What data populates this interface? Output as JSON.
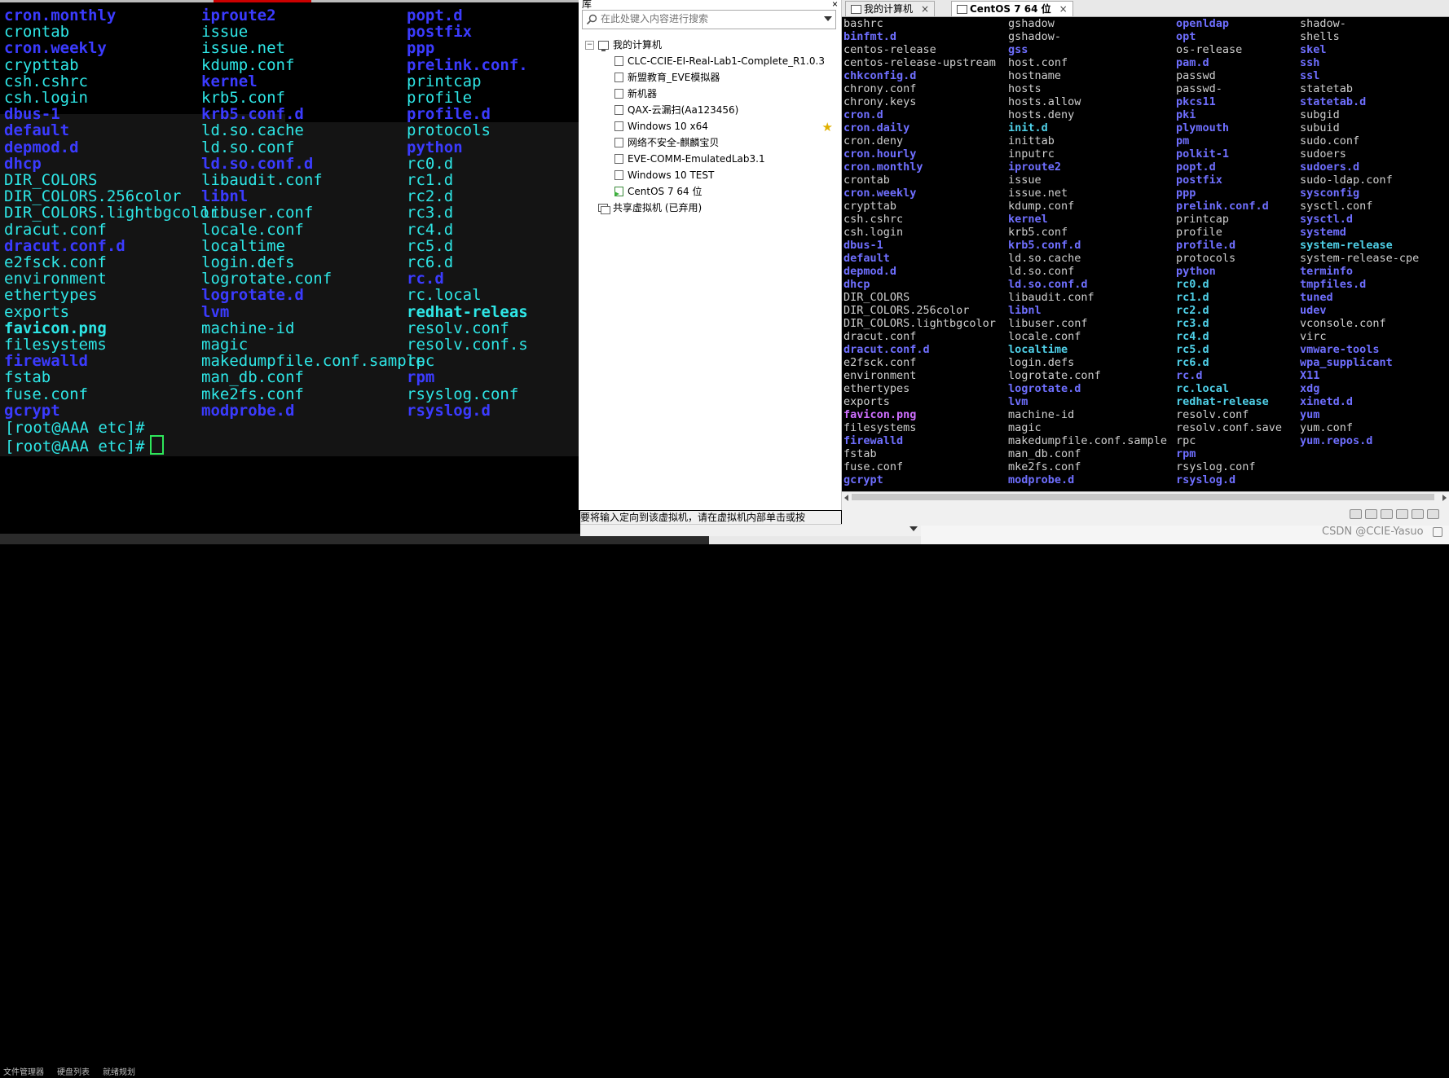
{
  "left_terminal": {
    "columns": [
      [
        {
          "t": "cron.monthly",
          "c": "blue"
        },
        {
          "t": "crontab",
          "c": "cyan"
        },
        {
          "t": "cron.weekly",
          "c": "blue"
        },
        {
          "t": "crypttab",
          "c": "cyan"
        },
        {
          "t": "csh.cshrc",
          "c": "cyan"
        },
        {
          "t": "csh.login",
          "c": "cyan"
        },
        {
          "t": "dbus-1",
          "c": "blue"
        },
        {
          "t": "default",
          "c": "blue"
        },
        {
          "t": "depmod.d",
          "c": "blue"
        },
        {
          "t": "dhcp",
          "c": "blue"
        },
        {
          "t": "DIR_COLORS",
          "c": "cyan"
        },
        {
          "t": "DIR_COLORS.256color",
          "c": "cyan"
        },
        {
          "t": "DIR_COLORS.lightbgcolor",
          "c": "cyan"
        },
        {
          "t": "dracut.conf",
          "c": "cyan"
        },
        {
          "t": "dracut.conf.d",
          "c": "blue"
        },
        {
          "t": "e2fsck.conf",
          "c": "cyan"
        },
        {
          "t": "environment",
          "c": "cyan"
        },
        {
          "t": "ethertypes",
          "c": "cyan"
        },
        {
          "t": "exports",
          "c": "cyan"
        },
        {
          "t": "favicon.png",
          "c": "cyan-bold"
        },
        {
          "t": "filesystems",
          "c": "cyan"
        },
        {
          "t": "firewalld",
          "c": "blue"
        },
        {
          "t": "fstab",
          "c": "cyan"
        },
        {
          "t": "fuse.conf",
          "c": "cyan"
        },
        {
          "t": "gcrypt",
          "c": "blue"
        }
      ],
      [
        {
          "t": "iproute2",
          "c": "blue"
        },
        {
          "t": "issue",
          "c": "cyan"
        },
        {
          "t": "issue.net",
          "c": "cyan"
        },
        {
          "t": "kdump.conf",
          "c": "cyan"
        },
        {
          "t": "kernel",
          "c": "blue"
        },
        {
          "t": "krb5.conf",
          "c": "cyan"
        },
        {
          "t": "krb5.conf.d",
          "c": "blue"
        },
        {
          "t": "ld.so.cache",
          "c": "cyan"
        },
        {
          "t": "ld.so.conf",
          "c": "cyan"
        },
        {
          "t": "ld.so.conf.d",
          "c": "blue"
        },
        {
          "t": "libaudit.conf",
          "c": "cyan"
        },
        {
          "t": "libnl",
          "c": "blue"
        },
        {
          "t": "libuser.conf",
          "c": "cyan"
        },
        {
          "t": "locale.conf",
          "c": "cyan"
        },
        {
          "t": "localtime",
          "c": "cyan"
        },
        {
          "t": "login.defs",
          "c": "cyan"
        },
        {
          "t": "logrotate.conf",
          "c": "cyan"
        },
        {
          "t": "logrotate.d",
          "c": "blue"
        },
        {
          "t": "lvm",
          "c": "blue"
        },
        {
          "t": "machine-id",
          "c": "cyan"
        },
        {
          "t": "magic",
          "c": "cyan"
        },
        {
          "t": "makedumpfile.conf.sample",
          "c": "cyan"
        },
        {
          "t": "man_db.conf",
          "c": "cyan"
        },
        {
          "t": "mke2fs.conf",
          "c": "cyan"
        },
        {
          "t": "modprobe.d",
          "c": "blue"
        }
      ],
      [
        {
          "t": "popt.d",
          "c": "blue"
        },
        {
          "t": "postfix",
          "c": "blue"
        },
        {
          "t": "ppp",
          "c": "blue"
        },
        {
          "t": "prelink.conf.",
          "c": "blue"
        },
        {
          "t": "printcap",
          "c": "cyan"
        },
        {
          "t": "profile",
          "c": "cyan"
        },
        {
          "t": "profile.d",
          "c": "blue"
        },
        {
          "t": "protocols",
          "c": "cyan"
        },
        {
          "t": "python",
          "c": "blue"
        },
        {
          "t": "rc0.d",
          "c": "cyan"
        },
        {
          "t": "rc1.d",
          "c": "cyan"
        },
        {
          "t": "rc2.d",
          "c": "cyan"
        },
        {
          "t": "rc3.d",
          "c": "cyan"
        },
        {
          "t": "rc4.d",
          "c": "cyan"
        },
        {
          "t": "rc5.d",
          "c": "cyan"
        },
        {
          "t": "rc6.d",
          "c": "cyan"
        },
        {
          "t": "rc.d",
          "c": "blue"
        },
        {
          "t": "rc.local",
          "c": "cyan"
        },
        {
          "t": "redhat-releas",
          "c": "cyan-bold"
        },
        {
          "t": "resolv.conf",
          "c": "cyan"
        },
        {
          "t": "resolv.conf.s",
          "c": "cyan"
        },
        {
          "t": "rpc",
          "c": "cyan"
        },
        {
          "t": "rpm",
          "c": "blue"
        },
        {
          "t": "rsyslog.conf",
          "c": "cyan"
        },
        {
          "t": "rsyslog.d",
          "c": "blue"
        }
      ]
    ],
    "prompts": [
      "[root@AAA etc]#",
      "[root@AAA etc]#"
    ]
  },
  "library": {
    "title": "库",
    "close_label": "×",
    "search_placeholder": "在此处键入内容进行搜索",
    "root": {
      "label": "我的计算机",
      "toggle": "−"
    },
    "vms": [
      {
        "label": "CLC-CCIE-EI-Real-Lab1-Complete_R1.0.3",
        "running": false,
        "star": false
      },
      {
        "label": "新盟教育_EVE模拟器",
        "running": false,
        "star": false
      },
      {
        "label": "新机器",
        "running": false,
        "star": false
      },
      {
        "label": "QAX-云漏扫(Aa123456)",
        "running": false,
        "star": false
      },
      {
        "label": "Windows 10 x64",
        "running": false,
        "star": true
      },
      {
        "label": "网络不安全-麒麟宝贝",
        "running": false,
        "star": false
      },
      {
        "label": "EVE-COMM-EmulatedLab3.1",
        "running": false,
        "star": false
      },
      {
        "label": "Windows 10 TEST",
        "running": false,
        "star": false
      },
      {
        "label": "CentOS 7 64 位",
        "running": true,
        "star": false
      }
    ],
    "shared": {
      "label": "共享虚拟机 (已弃用)"
    },
    "status_message": "要将输入定向到该虚拟机，请在虚拟机内部单击或按 Ctrl+G。",
    "star_glyph": "★"
  },
  "vm_tabs": [
    {
      "label": "我的计算机",
      "active": false,
      "close": "×"
    },
    {
      "label": "CentOS 7 64 位",
      "active": true,
      "close": "×"
    }
  ],
  "vm_terminal": {
    "columns": [
      [
        {
          "t": "bashrc",
          "c": "w"
        },
        {
          "t": "binfmt.d",
          "c": "b"
        },
        {
          "t": "centos-release",
          "c": "w"
        },
        {
          "t": "centos-release-upstream",
          "c": "w"
        },
        {
          "t": "chkconfig.d",
          "c": "b"
        },
        {
          "t": "chrony.conf",
          "c": "w"
        },
        {
          "t": "chrony.keys",
          "c": "w"
        },
        {
          "t": "cron.d",
          "c": "b"
        },
        {
          "t": "cron.daily",
          "c": "b"
        },
        {
          "t": "cron.deny",
          "c": "w"
        },
        {
          "t": "cron.hourly",
          "c": "b"
        },
        {
          "t": "cron.monthly",
          "c": "b"
        },
        {
          "t": "crontab",
          "c": "w"
        },
        {
          "t": "cron.weekly",
          "c": "b"
        },
        {
          "t": "crypttab",
          "c": "w"
        },
        {
          "t": "csh.cshrc",
          "c": "w"
        },
        {
          "t": "csh.login",
          "c": "w"
        },
        {
          "t": "dbus-1",
          "c": "b"
        },
        {
          "t": "default",
          "c": "b"
        },
        {
          "t": "depmod.d",
          "c": "b"
        },
        {
          "t": "dhcp",
          "c": "b"
        },
        {
          "t": "DIR_COLORS",
          "c": "w"
        },
        {
          "t": "DIR_COLORS.256color",
          "c": "w"
        },
        {
          "t": "DIR_COLORS.lightbgcolor",
          "c": "w"
        },
        {
          "t": "dracut.conf",
          "c": "w"
        },
        {
          "t": "dracut.conf.d",
          "c": "b"
        },
        {
          "t": "e2fsck.conf",
          "c": "w"
        },
        {
          "t": "environment",
          "c": "w"
        },
        {
          "t": "ethertypes",
          "c": "w"
        },
        {
          "t": "exports",
          "c": "w"
        },
        {
          "t": "favicon.png",
          "c": "m"
        },
        {
          "t": "filesystems",
          "c": "w"
        },
        {
          "t": "firewalld",
          "c": "b"
        },
        {
          "t": "fstab",
          "c": "w"
        },
        {
          "t": "fuse.conf",
          "c": "w"
        },
        {
          "t": "gcrypt",
          "c": "b"
        }
      ],
      [
        {
          "t": "gshadow",
          "c": "w"
        },
        {
          "t": "gshadow-",
          "c": "w"
        },
        {
          "t": "gss",
          "c": "b"
        },
        {
          "t": "host.conf",
          "c": "w"
        },
        {
          "t": "hostname",
          "c": "w"
        },
        {
          "t": "hosts",
          "c": "w"
        },
        {
          "t": "hosts.allow",
          "c": "w"
        },
        {
          "t": "hosts.deny",
          "c": "w"
        },
        {
          "t": "init.d",
          "c": "c"
        },
        {
          "t": "inittab",
          "c": "w"
        },
        {
          "t": "inputrc",
          "c": "w"
        },
        {
          "t": "iproute2",
          "c": "b"
        },
        {
          "t": "issue",
          "c": "w"
        },
        {
          "t": "issue.net",
          "c": "w"
        },
        {
          "t": "kdump.conf",
          "c": "w"
        },
        {
          "t": "kernel",
          "c": "b"
        },
        {
          "t": "krb5.conf",
          "c": "w"
        },
        {
          "t": "krb5.conf.d",
          "c": "b"
        },
        {
          "t": "ld.so.cache",
          "c": "w"
        },
        {
          "t": "ld.so.conf",
          "c": "w"
        },
        {
          "t": "ld.so.conf.d",
          "c": "b"
        },
        {
          "t": "libaudit.conf",
          "c": "w"
        },
        {
          "t": "libnl",
          "c": "b"
        },
        {
          "t": "libuser.conf",
          "c": "w"
        },
        {
          "t": "locale.conf",
          "c": "w"
        },
        {
          "t": "localtime",
          "c": "c"
        },
        {
          "t": "login.defs",
          "c": "w"
        },
        {
          "t": "logrotate.conf",
          "c": "w"
        },
        {
          "t": "logrotate.d",
          "c": "b"
        },
        {
          "t": "lvm",
          "c": "b"
        },
        {
          "t": "machine-id",
          "c": "w"
        },
        {
          "t": "magic",
          "c": "w"
        },
        {
          "t": "makedumpfile.conf.sample",
          "c": "w"
        },
        {
          "t": "man_db.conf",
          "c": "w"
        },
        {
          "t": "mke2fs.conf",
          "c": "w"
        },
        {
          "t": "modprobe.d",
          "c": "b"
        }
      ],
      [
        {
          "t": "openldap",
          "c": "b"
        },
        {
          "t": "opt",
          "c": "b"
        },
        {
          "t": "os-release",
          "c": "w"
        },
        {
          "t": "pam.d",
          "c": "b"
        },
        {
          "t": "passwd",
          "c": "w"
        },
        {
          "t": "passwd-",
          "c": "w"
        },
        {
          "t": "pkcs11",
          "c": "b"
        },
        {
          "t": "pki",
          "c": "b"
        },
        {
          "t": "plymouth",
          "c": "b"
        },
        {
          "t": "pm",
          "c": "b"
        },
        {
          "t": "polkit-1",
          "c": "b"
        },
        {
          "t": "popt.d",
          "c": "b"
        },
        {
          "t": "postfix",
          "c": "b"
        },
        {
          "t": "ppp",
          "c": "b"
        },
        {
          "t": "prelink.conf.d",
          "c": "b"
        },
        {
          "t": "printcap",
          "c": "w"
        },
        {
          "t": "profile",
          "c": "w"
        },
        {
          "t": "profile.d",
          "c": "b"
        },
        {
          "t": "protocols",
          "c": "w"
        },
        {
          "t": "python",
          "c": "b"
        },
        {
          "t": "rc0.d",
          "c": "c"
        },
        {
          "t": "rc1.d",
          "c": "c"
        },
        {
          "t": "rc2.d",
          "c": "c"
        },
        {
          "t": "rc3.d",
          "c": "c"
        },
        {
          "t": "rc4.d",
          "c": "c"
        },
        {
          "t": "rc5.d",
          "c": "c"
        },
        {
          "t": "rc6.d",
          "c": "c"
        },
        {
          "t": "rc.d",
          "c": "b"
        },
        {
          "t": "rc.local",
          "c": "c"
        },
        {
          "t": "redhat-release",
          "c": "c"
        },
        {
          "t": "resolv.conf",
          "c": "w"
        },
        {
          "t": "resolv.conf.save",
          "c": "w"
        },
        {
          "t": "rpc",
          "c": "w"
        },
        {
          "t": "rpm",
          "c": "b"
        },
        {
          "t": "rsyslog.conf",
          "c": "w"
        },
        {
          "t": "rsyslog.d",
          "c": "b"
        }
      ],
      [
        {
          "t": "shadow-",
          "c": "w"
        },
        {
          "t": "shells",
          "c": "w"
        },
        {
          "t": "skel",
          "c": "b"
        },
        {
          "t": "ssh",
          "c": "b"
        },
        {
          "t": "ssl",
          "c": "b"
        },
        {
          "t": "statetab",
          "c": "w"
        },
        {
          "t": "statetab.d",
          "c": "b"
        },
        {
          "t": "subgid",
          "c": "w"
        },
        {
          "t": "subuid",
          "c": "w"
        },
        {
          "t": "sudo.conf",
          "c": "w"
        },
        {
          "t": "sudoers",
          "c": "w"
        },
        {
          "t": "sudoers.d",
          "c": "b"
        },
        {
          "t": "sudo-ldap.conf",
          "c": "w"
        },
        {
          "t": "sysconfig",
          "c": "b"
        },
        {
          "t": "sysctl.conf",
          "c": "w"
        },
        {
          "t": "sysctl.d",
          "c": "b"
        },
        {
          "t": "systemd",
          "c": "b"
        },
        {
          "t": "system-release",
          "c": "c"
        },
        {
          "t": "system-release-cpe",
          "c": "w"
        },
        {
          "t": "terminfo",
          "c": "b"
        },
        {
          "t": "tmpfiles.d",
          "c": "b"
        },
        {
          "t": "tuned",
          "c": "b"
        },
        {
          "t": "udev",
          "c": "b"
        },
        {
          "t": "vconsole.conf",
          "c": "w"
        },
        {
          "t": "virc",
          "c": "w"
        },
        {
          "t": "vmware-tools",
          "c": "b"
        },
        {
          "t": "wpa_supplicant",
          "c": "b"
        },
        {
          "t": "X11",
          "c": "b"
        },
        {
          "t": "xdg",
          "c": "b"
        },
        {
          "t": "xinetd.d",
          "c": "b"
        },
        {
          "t": "yum",
          "c": "b"
        },
        {
          "t": "yum.conf",
          "c": "w"
        },
        {
          "t": "yum.repos.d",
          "c": "b"
        }
      ]
    ]
  },
  "bottom_ghost_labels": [
    "文件管理器",
    "硬盘列表",
    "就绪规划"
  ],
  "watermark": "CSDN @CCIE-Yasuo",
  "colors": {
    "left_cyan": "#2ee6e6",
    "left_blue": "#3b3bff",
    "vm_white": "#cfcfcf",
    "vm_blue": "#6f6fff",
    "vm_cyan": "#4fd0e8",
    "vm_magenta": "#cf6fff"
  }
}
